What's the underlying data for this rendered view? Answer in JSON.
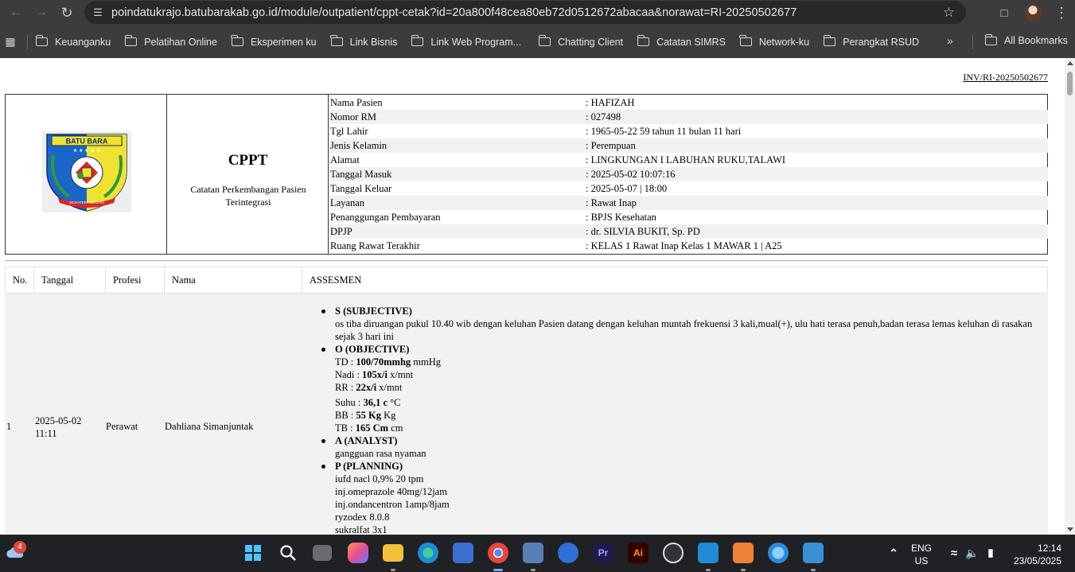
{
  "browser": {
    "url": "poindatukrajo.batubarakab.go.id/module/outpatient/cppt-cetak?id=20a800f48cea80eb72d0512672abacaa&norawat=RI-20250502677",
    "bookmarks": [
      "Keuanganku",
      "Pelatihan Online",
      "Eksperimen ku",
      "Link Bisnis",
      "Link Web Program...",
      "Chatting Client",
      "Catatan SIMRS",
      "Network-ku",
      "Perangkat RSUD"
    ],
    "more_label": "»",
    "all_bookmarks": "All Bookmarks"
  },
  "doc": {
    "invoice": "INV/RI-20250502677",
    "logo_text_top": "BATU BARA",
    "logo_text_bottom": "SEJAHTERA BERJAYA",
    "title": "CPPT",
    "subtitle": "Catatan Perkembangan Pasien Terintegrasi",
    "info": [
      {
        "label": "Nama Pasien",
        "value": ": HAFIZAH"
      },
      {
        "label": "Nomor RM",
        "value": ": 027498"
      },
      {
        "label": "Tgl Lahir",
        "value": ": 1965-05-22 59 tahun 11 bulan 11 hari"
      },
      {
        "label": "Jenis Kelamin",
        "value": ": Perempuan"
      },
      {
        "label": "Alamat",
        "value": ": LINGKUNGAN I LABUHAN RUKU,TALAWI"
      },
      {
        "label": "Tanggal Masuk",
        "value": ": 2025-05-02 10:07:16"
      },
      {
        "label": "Tanggal Keluar",
        "value": ": 2025-05-07 | 18:00"
      },
      {
        "label": "Layanan",
        "value": ": Rawat Inap"
      },
      {
        "label": "Penanggungan Pembayaran",
        "value": ": BPJS Kesehatan"
      },
      {
        "label": "DPJP",
        "value": ": dr. SILVIA BUKIT, Sp. PD"
      },
      {
        "label": "Ruang Rawat Terakhir",
        "value": ": KELAS 1 Rawat Inap Kelas 1 MAWAR 1 | A25"
      }
    ],
    "table_headers": {
      "no": "No.",
      "tanggal": "Tanggal",
      "profesi": "Profesi",
      "nama": "Nama",
      "assesmen": "ASSESMEN"
    },
    "row1": {
      "no": "1",
      "date": "2025-05-02",
      "time": "11:11",
      "profesi": "Perawat",
      "nama": "Dahliana Simanjuntak",
      "s_title": "S (SUBJECTIVE)",
      "s_text": "os tiba diruangan pukul 10.40 wib dengan keluhan  Pasien datang dengan keluhan muntah frekuensi 3 kali,mual(+), ulu hati terasa penuh,badan terasa lemas keluhan di rasakan sejak 3 hari ini",
      "o_title": "O (OBJECTIVE)",
      "o_td_label": "TD : ",
      "o_td_val": "100/70mmhg",
      "o_td_unit": " mmHg",
      "o_nadi_label": "Nadi : ",
      "o_nadi_val": "105x/i",
      "o_nadi_unit": " x/mnt",
      "o_rr_label": "RR : ",
      "o_rr_val": "22x/i",
      "o_rr_unit": " x/mnt",
      "o_suhu_label": "Suhu : ",
      "o_suhu_val": "36,1 c",
      "o_suhu_unit": " °C",
      "o_bb_label": "BB : ",
      "o_bb_val": "55 Kg",
      "o_bb_unit": " Kg",
      "o_tb_label": "TB : ",
      "o_tb_val": "165 Cm",
      "o_tb_unit": " cm",
      "a_title": "A (ANALYST)",
      "a_text": "gangguan rasa nyaman",
      "p_title": "P (PLANNING)",
      "p_lines": [
        "iufd nacl 0,9% 20 tpm",
        "inj.omeprazole 40mg/12jam",
        "inj.ondancentron 1amp/8jam",
        "ryzodex 8.0.8",
        "sukralfat 3x1"
      ]
    }
  },
  "taskbar": {
    "weather_badge": "4",
    "lang_top": "ENG",
    "lang_bottom": "US",
    "time": "12:14",
    "date": "23/05/2025"
  }
}
